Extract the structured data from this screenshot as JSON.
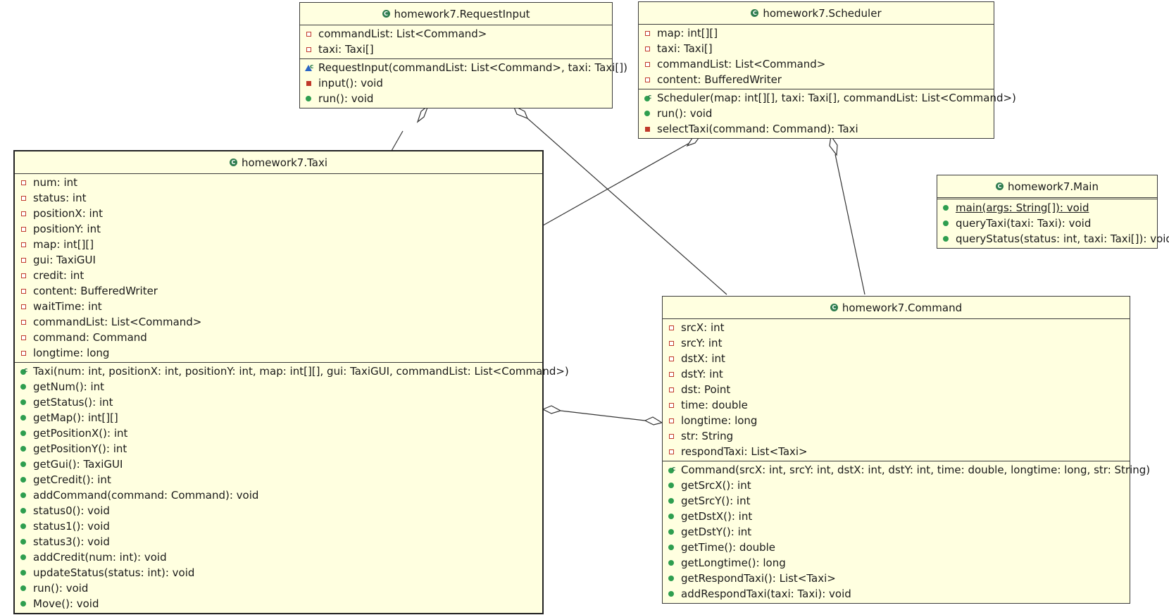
{
  "classes": {
    "requestinput": {
      "name": "homework7.RequestInput",
      "attributes": [
        "commandList: List<Command>",
        "taxi: Taxi[]"
      ],
      "operations": [
        "RequestInput(commandList: List<Command>, taxi: Taxi[])",
        "input(): void",
        "run(): void"
      ]
    },
    "scheduler": {
      "name": "homework7.Scheduler",
      "attributes": [
        "map: int[][]",
        "taxi: Taxi[]",
        "commandList: List<Command>",
        "content: BufferedWriter"
      ],
      "operations": [
        "Scheduler(map: int[][], taxi: Taxi[], commandList: List<Command>)",
        "run(): void",
        "selectTaxi(command: Command): Taxi"
      ]
    },
    "main": {
      "name": "homework7.Main",
      "operations": [
        "main(args: String[]): void",
        "queryTaxi(taxi: Taxi): void",
        "queryStatus(status: int, taxi: Taxi[]): void"
      ]
    },
    "taxi": {
      "name": "homework7.Taxi",
      "attributes": [
        "num: int",
        "status: int",
        "positionX: int",
        "positionY: int",
        "map: int[][]",
        "gui: TaxiGUI",
        "credit: int",
        "content: BufferedWriter",
        "waitTime: int",
        "commandList: List<Command>",
        "command: Command",
        "longtime: long"
      ],
      "operations": [
        "Taxi(num: int, positionX: int, positionY: int, map: int[][], gui: TaxiGUI, commandList: List<Command>)",
        "getNum(): int",
        "getStatus(): int",
        "getMap(): int[][]",
        "getPositionX(): int",
        "getPositionY(): int",
        "getGui(): TaxiGUI",
        "getCredit(): int",
        "addCommand(command: Command): void",
        "status0(): void",
        "status1(): void",
        "status3(): void",
        "addCredit(num: int): void",
        "updateStatus(status: int): void",
        "run(): void",
        "Move(): void"
      ]
    },
    "command": {
      "name": "homework7.Command",
      "attributes": [
        "srcX: int",
        "srcY: int",
        "dstX: int",
        "dstY: int",
        "dst: Point",
        "time: double",
        "longtime: long",
        "str: String",
        "respondTaxi: List<Taxi>"
      ],
      "operations": [
        "Command(srcX: int, srcY: int, dstX: int, dstY: int, time: double, longtime: long, str: String)",
        "getSrcX(): int",
        "getSrcY(): int",
        "getDstX(): int",
        "getDstY(): int",
        "getTime(): double",
        "getLongtime(): long",
        "getRespondTaxi(): List<Taxi>",
        "addRespondTaxi(taxi: Taxi): void"
      ]
    }
  },
  "relations": [
    {
      "type": "aggregation",
      "whole": "homework7.RequestInput",
      "part": "homework7.Taxi"
    },
    {
      "type": "aggregation",
      "whole": "homework7.RequestInput",
      "part": "homework7.Command"
    },
    {
      "type": "aggregation",
      "whole": "homework7.Scheduler",
      "part": "homework7.Taxi"
    },
    {
      "type": "aggregation",
      "whole": "homework7.Scheduler",
      "part": "homework7.Command"
    },
    {
      "type": "aggregation",
      "whole": "homework7.Taxi",
      "part": "homework7.Command"
    },
    {
      "type": "aggregation",
      "whole": "homework7.Command",
      "part": "homework7.Taxi"
    }
  ],
  "colors": {
    "class_fill": "#ffffe0",
    "border": "#3a3a3a",
    "public": "#2e9e4f",
    "private": "#c0392b",
    "package": "#2b65c4"
  }
}
